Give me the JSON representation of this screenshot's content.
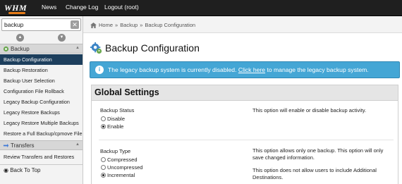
{
  "topbar": {
    "logo": "WHM",
    "nav": [
      "News",
      "Change Log",
      "Logout (root)"
    ]
  },
  "sidebar": {
    "search": {
      "value": "backup",
      "placeholder": ""
    },
    "categories": [
      {
        "label": "Backup",
        "items": [
          "Backup Configuration",
          "Backup Restoration",
          "Backup User Selection",
          "Configuration File Rollback",
          "Legacy Backup Configuration",
          "Legacy Restore Backups",
          "Legacy Restore Multiple Backups",
          "Restore a Full Backup/cpmove File"
        ],
        "active_index": 0
      },
      {
        "label": "Transfers",
        "items": [
          "Review Transfers and Restores"
        ]
      }
    ],
    "back_to_top": "Back To Top"
  },
  "breadcrumb": {
    "home": "Home",
    "section": "Backup",
    "current": "Backup Configuration",
    "separator": "»"
  },
  "page": {
    "title": "Backup Configuration",
    "alert": {
      "before": "The legacy backup system is currently disabled.",
      "link": "Click here",
      "after": "to manage the legacy backup system."
    },
    "panel_title": "Global Settings",
    "settings": {
      "backup_status": {
        "label": "Backup Status",
        "options": [
          "Disable",
          "Enable"
        ],
        "selected": "Enable",
        "description": "This option will enable or disable backup activity."
      },
      "backup_type": {
        "label": "Backup Type",
        "options": [
          "Compressed",
          "Uncompressed",
          "Incremental"
        ],
        "selected": "Incremental",
        "descriptions": [
          "This option allows only one backup. This option will only save changed information.",
          "This option does not allow users to include Additional Destinations."
        ]
      }
    }
  },
  "colors": {
    "topbar": "#1f1f1f",
    "active_item": "#1d3f5d",
    "alert": "#44a6d5"
  }
}
